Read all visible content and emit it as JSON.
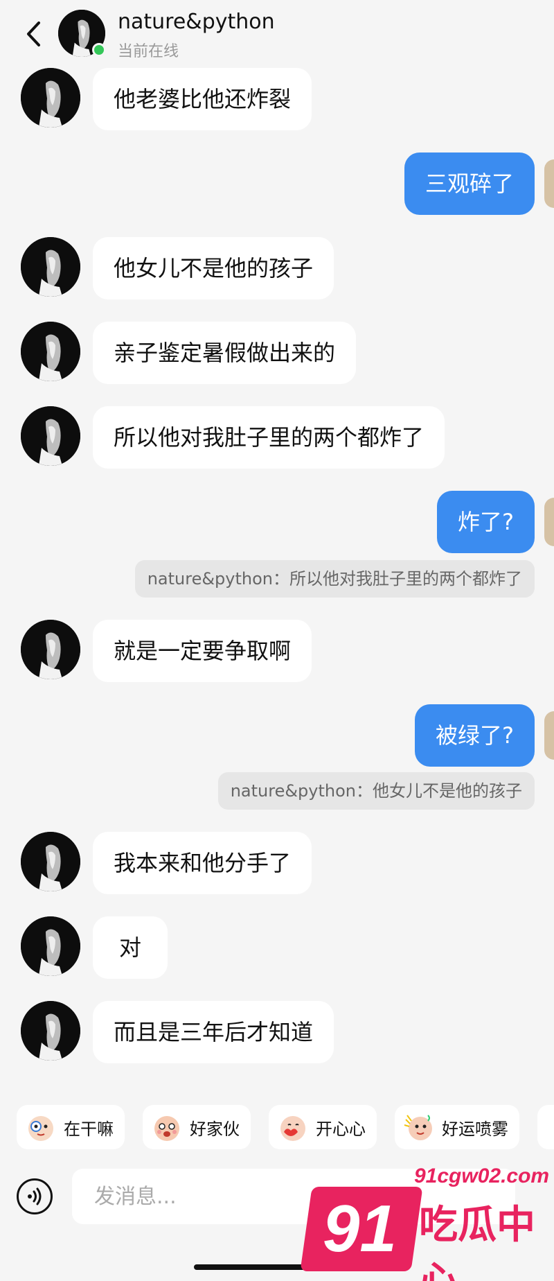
{
  "header": {
    "contact_name": "nature&python",
    "status": "当前在线"
  },
  "messages": [
    {
      "dir": "in",
      "text": "他老婆比他还炸裂"
    },
    {
      "dir": "out",
      "text": "三观碎了"
    },
    {
      "dir": "in",
      "text": "他女儿不是他的孩子"
    },
    {
      "dir": "in",
      "text": "亲子鉴定暑假做出来的"
    },
    {
      "dir": "in",
      "text": "所以他对我肚子里的两个都炸了"
    },
    {
      "dir": "out",
      "text": "炸了?"
    },
    {
      "dir": "quote",
      "text": "nature&python：所以他对我肚子里的两个都炸了"
    },
    {
      "dir": "in",
      "text": "就是一定要争取啊"
    },
    {
      "dir": "out",
      "text": "被绿了?"
    },
    {
      "dir": "quote",
      "text": "nature&python：他女儿不是他的孩子"
    },
    {
      "dir": "in",
      "text": "我本来和他分手了"
    },
    {
      "dir": "in",
      "text": "对"
    },
    {
      "dir": "in",
      "text": "而且是三年后才知道"
    }
  ],
  "quick_replies": [
    {
      "label": "在干嘛",
      "icon": "sticker-icon"
    },
    {
      "label": "好家伙",
      "icon": "sticker-icon"
    },
    {
      "label": "开心心",
      "icon": "sticker-icon"
    },
    {
      "label": "好运喷雾",
      "icon": "sticker-icon"
    }
  ],
  "input": {
    "placeholder": "发消息..."
  },
  "watermark": {
    "url": "91cgw02.com",
    "number": "91",
    "brand": "吃瓜中心"
  },
  "colors": {
    "outgoing_bubble": "#3b8cf0",
    "incoming_bubble": "#ffffff",
    "background": "#f5f5f5",
    "online": "#34c759",
    "watermark": "#e8235f"
  }
}
